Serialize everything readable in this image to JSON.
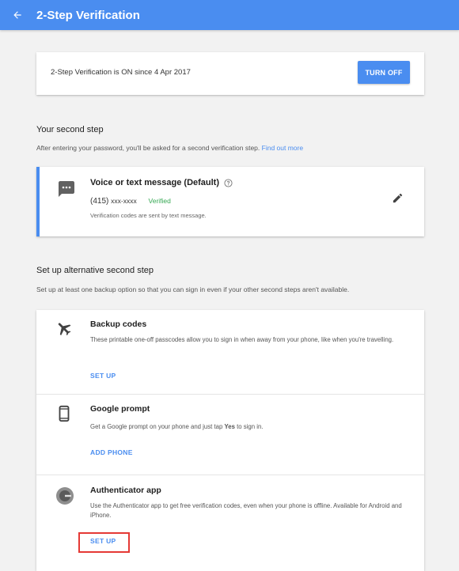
{
  "app_bar": {
    "title": "2-Step Verification",
    "back_icon": "arrow-back-icon",
    "color": "#4a8df0"
  },
  "status": {
    "text": "2-Step Verification is ON since 4 Apr 2017",
    "button_label": "TURN OFF"
  },
  "second_step": {
    "heading": "Your second step",
    "description": "After entering your password, you'll be asked for a second verification step.",
    "link": "Find out more",
    "method": {
      "title": "Voice or text message (Default)",
      "phone_prefix": "(415)",
      "phone_masked": "xxx-xxxx",
      "status": "Verified",
      "note": "Verification codes are sent by text message.",
      "icon": "message-icon",
      "edit_icon": "pencil-icon"
    }
  },
  "alternative": {
    "heading": "Set up alternative second step",
    "description": "Set up at least one backup option so that you can sign in even if your other second steps aren't available.",
    "items": [
      {
        "title": "Backup codes",
        "description": "These printable one-off passcodes allow you to sign in when away from your phone, like when you're travelling.",
        "action": "SET UP",
        "icon": "airplane-icon"
      },
      {
        "title": "Google prompt",
        "description_prefix": "Get a Google prompt on your phone and just tap ",
        "description_bold": "Yes",
        "description_suffix": " to sign in.",
        "action": "ADD PHONE",
        "icon": "phone-icon"
      },
      {
        "title": "Authenticator app",
        "description": "Use the Authenticator app to get free verification codes, even when your phone is offline. Available for Android and iPhone.",
        "action": "SET UP",
        "icon": "authenticator-icon"
      }
    ]
  }
}
